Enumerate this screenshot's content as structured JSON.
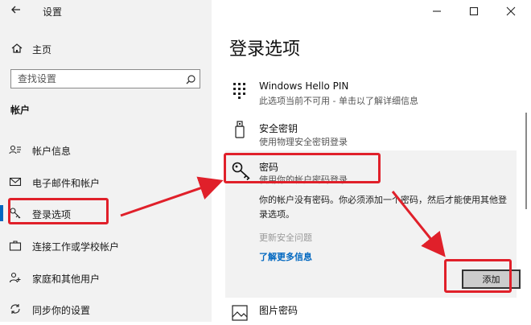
{
  "app": {
    "title": "设置"
  },
  "sidebar": {
    "home": "主页",
    "search_placeholder": "查找设置",
    "section": "帐户",
    "items": [
      {
        "label": "帐户信息",
        "icon": "person-icon"
      },
      {
        "label": "电子邮件和帐户",
        "icon": "mail-icon"
      },
      {
        "label": "登录选项",
        "icon": "key-icon",
        "selected": true
      },
      {
        "label": "连接工作或学校帐户",
        "icon": "briefcase-icon"
      },
      {
        "label": "家庭和其他用户",
        "icon": "people-icon"
      },
      {
        "label": "同步你的设置",
        "icon": "sync-icon"
      }
    ]
  },
  "main": {
    "title": "登录选项",
    "options": [
      {
        "title": "Windows Hello PIN",
        "desc": "此选项当前不可用 - 单击以了解详细信息",
        "icon": "keypad-icon"
      },
      {
        "title": "安全密钥",
        "desc": "使用物理安全密钥登录",
        "icon": "usb-key-icon"
      },
      {
        "title": "密码",
        "desc": "使用你的帐户密码登录",
        "icon": "key-icon"
      },
      {
        "title": "图片密码",
        "desc": "",
        "icon": "picture-icon"
      }
    ],
    "password_panel": {
      "message": "你的帐户没有密码。你必须添加一个密码，然后才能使用其他登录选项。",
      "disabled_link": "更新安全问题",
      "learn_more": "了解更多信息",
      "add_button": "添加"
    }
  },
  "colors": {
    "accent": "#0067c0",
    "highlight": "#e0202a"
  }
}
